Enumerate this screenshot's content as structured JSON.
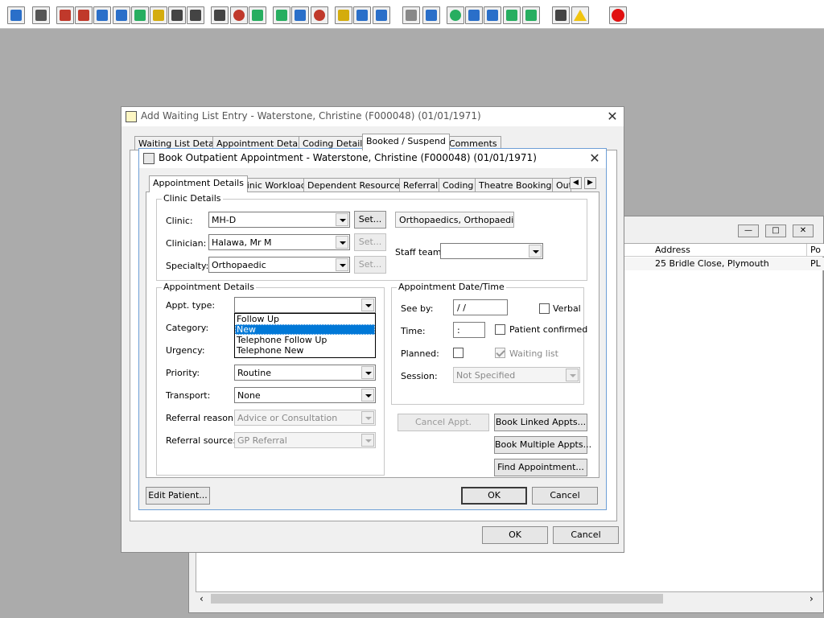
{
  "toolbar": {
    "buttons": [
      {
        "icon": "person-icon",
        "color": "#2a6fc9"
      },
      {
        "icon": "printer-icon",
        "color": "#555555"
      },
      {
        "icon": "book-icon",
        "color": "#c0392b"
      },
      {
        "icon": "edit-icon",
        "color": "#c0392b"
      },
      {
        "icon": "form-icon",
        "color": "#2a6fc9"
      },
      {
        "icon": "m-icon",
        "color": "#2a6fc9"
      },
      {
        "icon": "doctor-icon",
        "color": "#27ae60"
      },
      {
        "icon": "notes-icon",
        "color": "#d4ac0d"
      },
      {
        "icon": "ambulance-icon",
        "color": "#444444"
      },
      {
        "icon": "ambulance2-icon",
        "color": "#444444"
      },
      {
        "icon": "search-icon",
        "color": "#444444"
      },
      {
        "icon": "clock-icon",
        "color": "#c0392b"
      },
      {
        "icon": "monitor-icon",
        "color": "#27ae60"
      },
      {
        "icon": "chart-icon",
        "color": "#27ae60"
      },
      {
        "icon": "calendar-icon",
        "color": "#2a6fc9"
      },
      {
        "icon": "stopwatch-icon",
        "color": "#c0392b"
      },
      {
        "icon": "list-icon",
        "color": "#d4ac0d"
      },
      {
        "icon": "bed-icon",
        "color": "#2a6fc9"
      },
      {
        "icon": "admit-icon",
        "color": "#2a6fc9"
      },
      {
        "icon": "document-icon",
        "color": "#888888"
      },
      {
        "icon": "bar-chart-icon",
        "color": "#2a6fc9"
      },
      {
        "icon": "globe-icon",
        "color": "#27ae60"
      },
      {
        "icon": "message-icon",
        "color": "#2a6fc9"
      },
      {
        "icon": "inbox-icon",
        "color": "#2a6fc9"
      },
      {
        "icon": "download-icon",
        "color": "#27ae60"
      },
      {
        "icon": "upload-icon",
        "color": "#27ae60"
      },
      {
        "icon": "swap-icon",
        "color": "#444444"
      },
      {
        "icon": "warning-icon",
        "color": "#f1c40f"
      },
      {
        "icon": "exit-icon",
        "color": "#e11111"
      }
    ]
  },
  "bg_window": {
    "columns": [
      "Address",
      "Po"
    ],
    "row": {
      "address": "25 Bridle Close, Plymouth",
      "postcode": "PL"
    }
  },
  "outer_dialog": {
    "title": "Add Waiting List Entry - Waterstone, Christine (F000048) (01/01/1971)",
    "tabs": [
      "Waiting List Details",
      "Appointment Details",
      "Coding Details",
      "Booked / Suspend",
      "Comments"
    ],
    "ok_label": "OK",
    "cancel_label": "Cancel"
  },
  "inner_dialog": {
    "title": "Book Outpatient Appointment - Waterstone, Christine (F000048) (01/01/1971)",
    "tabs": [
      "Appointment Details",
      "Clinic Workload",
      "Dependent Resources",
      "Referral",
      "Coding",
      "Theatre Bookings",
      "Out"
    ],
    "clinic_details": {
      "label": "Clinic Details",
      "clinic_label": "Clinic:",
      "clinic_value": "MH-D",
      "clinician_label": "Clinician:",
      "clinician_value": "Halawa, Mr M",
      "specialty_label": "Specialty:",
      "specialty_value": "Orthopaedic",
      "set_label": "Set...",
      "clinic_desc": "Orthopaedics, Orthopaedic OP",
      "staff_team_label": "Staff team:",
      "staff_team_value": ""
    },
    "appt_details": {
      "label": "Appointment Details",
      "appt_type_label": "Appt. type:",
      "appt_type_value": "",
      "appt_type_options": [
        "Follow Up",
        "New",
        "Telephone Follow Up",
        "Telephone New"
      ],
      "appt_type_highlighted": "New",
      "category_label": "Category:",
      "urgency_label": "Urgency:",
      "priority_label": "Priority:",
      "priority_value": "Routine",
      "transport_label": "Transport:",
      "transport_value": "None",
      "referral_reason_label": "Referral reason:",
      "referral_reason_value": "Advice or Consultation",
      "referral_source_label": "Referral source:",
      "referral_source_value": "GP Referral"
    },
    "appt_datetime": {
      "label": "Appointment Date/Time",
      "see_by_label": "See by:",
      "see_by_value": " /  /",
      "verbal_label": "Verbal",
      "time_label": "Time:",
      "time_value": " :",
      "patient_confirmed_label": "Patient confirmed",
      "planned_label": "Planned:",
      "waiting_list_label": "Waiting list",
      "session_label": "Session:",
      "session_value": "Not Specified"
    },
    "buttons": {
      "cancel_appt": "Cancel Appt.",
      "book_linked": "Book Linked Appts...",
      "book_multiple": "Book Multiple Appts...",
      "find_appointment": "Find Appointment...",
      "edit_patient": "Edit Patient...",
      "ok": "OK",
      "cancel": "Cancel"
    }
  }
}
